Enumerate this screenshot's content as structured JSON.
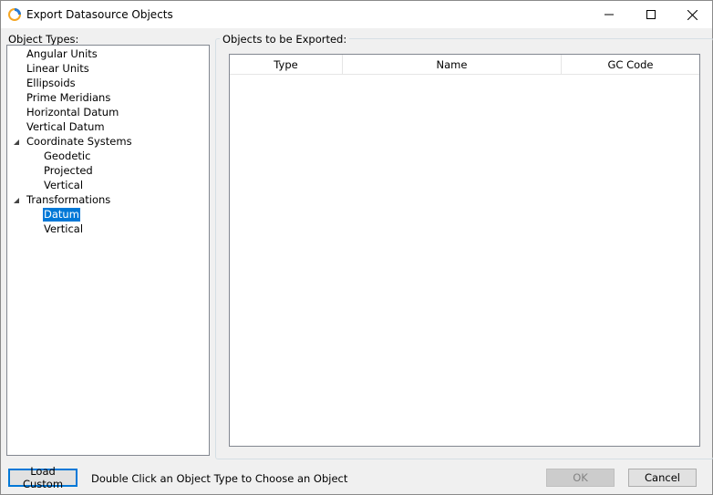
{
  "window": {
    "title": "Export Datasource Objects",
    "controls": {
      "minimize": "minimize-icon",
      "maximize": "maximize-icon",
      "close": "close-icon"
    }
  },
  "object_types": {
    "label": "Object Types:",
    "items": [
      {
        "label": "Angular Units",
        "level": 1,
        "expandable": false,
        "selected": false
      },
      {
        "label": "Linear Units",
        "level": 1,
        "expandable": false,
        "selected": false
      },
      {
        "label": "Ellipsoids",
        "level": 1,
        "expandable": false,
        "selected": false
      },
      {
        "label": "Prime Meridians",
        "level": 1,
        "expandable": false,
        "selected": false
      },
      {
        "label": "Horizontal Datum",
        "level": 1,
        "expandable": false,
        "selected": false
      },
      {
        "label": "Vertical Datum",
        "level": 1,
        "expandable": false,
        "selected": false
      },
      {
        "label": "Coordinate Systems",
        "level": 1,
        "expandable": true,
        "expanded": true,
        "selected": false
      },
      {
        "label": "Geodetic",
        "level": 2,
        "expandable": false,
        "selected": false
      },
      {
        "label": "Projected",
        "level": 2,
        "expandable": false,
        "selected": false
      },
      {
        "label": "Vertical",
        "level": 2,
        "expandable": false,
        "selected": false
      },
      {
        "label": "Transformations",
        "level": 1,
        "expandable": true,
        "expanded": true,
        "selected": false
      },
      {
        "label": "Datum",
        "level": 2,
        "expandable": false,
        "selected": true
      },
      {
        "label": "Vertical",
        "level": 2,
        "expandable": false,
        "selected": false
      }
    ]
  },
  "export_list": {
    "label": "Objects to be Exported:",
    "columns": [
      "Type",
      "Name",
      "GC Code"
    ],
    "rows": []
  },
  "footer": {
    "load_custom_label": "Load Custom",
    "hint": "Double Click an Object Type to Choose an Object",
    "ok_label": "OK",
    "cancel_label": "Cancel"
  },
  "colors": {
    "selection": "#0078d7",
    "window_bg": "#f0f0f0",
    "disabled_text": "#838383"
  }
}
